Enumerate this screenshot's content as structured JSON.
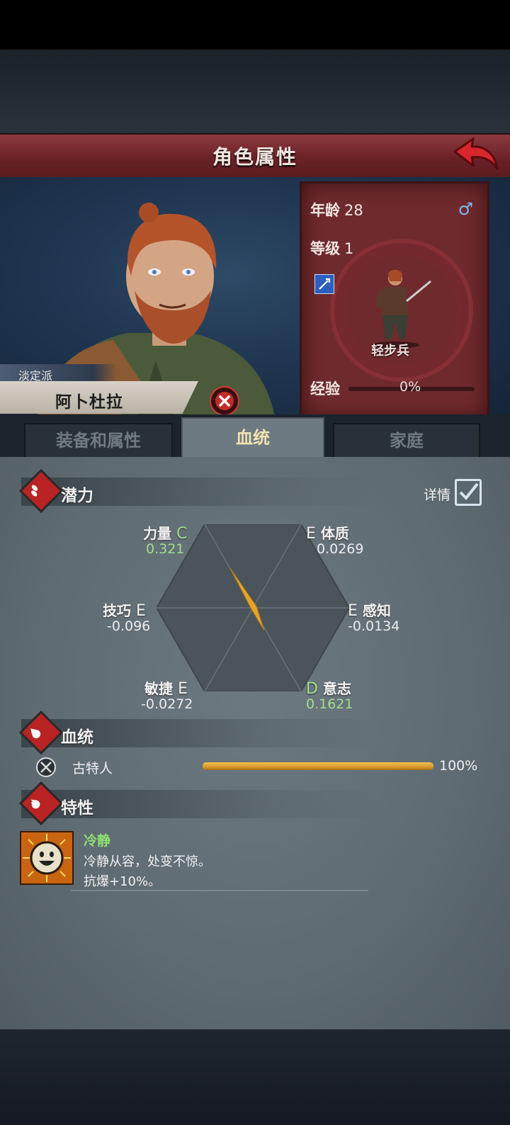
{
  "header": {
    "title": "角色属性"
  },
  "character": {
    "faction": "淡定派",
    "name": "阿卜杜拉",
    "age_label": "年龄",
    "age": "28",
    "gender_symbol": "♂",
    "level_label": "等级",
    "level": "1",
    "unit_type": "轻步兵",
    "exp_label": "经验",
    "exp_value": "0%",
    "exp_fraction": 0.0
  },
  "tabs": [
    {
      "label": "装备和属性",
      "active": false
    },
    {
      "label": "血统",
      "active": true
    },
    {
      "label": "家庭",
      "active": false
    }
  ],
  "potential": {
    "section_title": "潜力",
    "detail_label": "详情",
    "detail_checked": true,
    "attributes": [
      {
        "name": "力量",
        "grade": "C",
        "value": "0.321"
      },
      {
        "name": "体质",
        "grade": "E",
        "value": "0.0269"
      },
      {
        "name": "技巧",
        "grade": "E",
        "value": "-0.096"
      },
      {
        "name": "感知",
        "grade": "E",
        "value": "-0.0134"
      },
      {
        "name": "敏捷",
        "grade": "E",
        "value": "-0.0272"
      },
      {
        "name": "意志",
        "grade": "D",
        "value": "0.1621"
      }
    ]
  },
  "lineage": {
    "section_title": "血统",
    "items": [
      {
        "name": "古特人",
        "percent_label": "100%",
        "fraction": 1.0
      }
    ]
  },
  "traits": {
    "section_title": "特性",
    "items": [
      {
        "name": "冷静",
        "desc_line1": "冷静从容，处变不惊。",
        "desc_line2": "抗爆+10%。"
      }
    ]
  },
  "colors": {
    "accent_red": "#b92323",
    "grade_green": "#9fe08a",
    "lineage_gold": "#e0a436"
  }
}
